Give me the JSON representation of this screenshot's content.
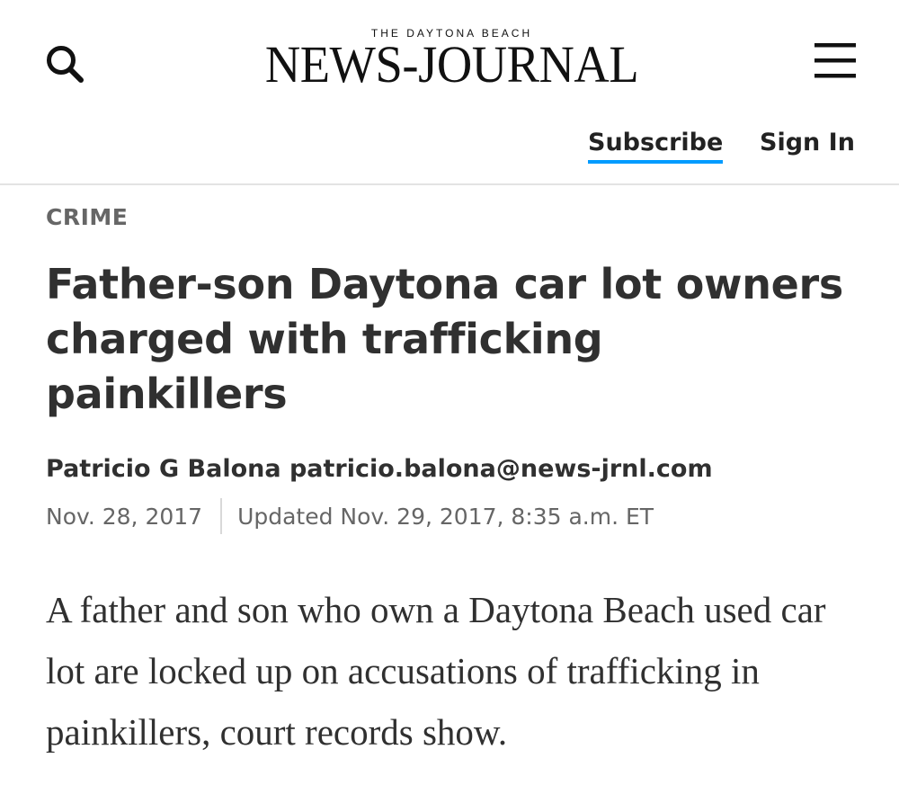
{
  "header": {
    "masthead_kicker": "THE DAYTONA BEACH",
    "masthead_name": "NEWS-JOURNAL",
    "search_icon": "search-icon",
    "menu_icon": "hamburger-menu-icon",
    "subscribe_label": "Subscribe",
    "signin_label": "Sign In",
    "accent_color": "#009bff"
  },
  "article": {
    "section": "CRIME",
    "headline": "Father-son Daytona car lot owners charged with trafficking painkillers",
    "byline": "Patricio G Balona patricio.balona@news-jrnl.com",
    "published": "Nov. 28, 2017",
    "updated": "Updated Nov. 29, 2017, 8:35 a.m. ET",
    "lede": "A father and son who own a Daytona Beach used car lot are locked up on accusations of trafficking in painkillers, court records show."
  }
}
